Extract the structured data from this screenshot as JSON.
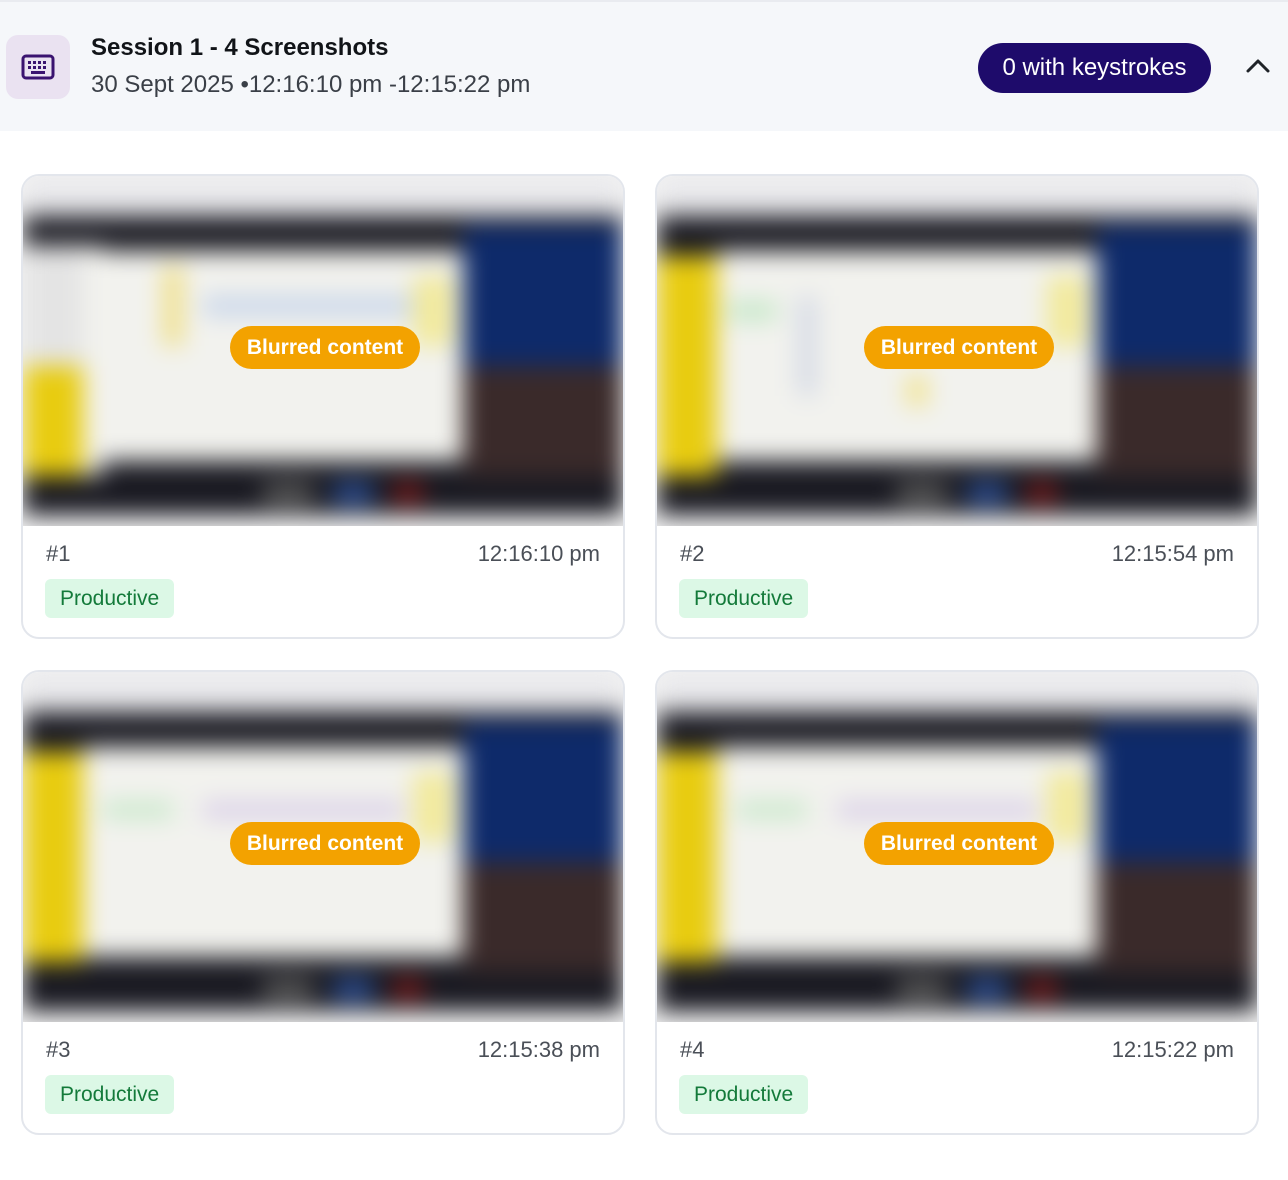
{
  "session": {
    "title": "Session 1 - 4 Screenshots",
    "subtitle": "30 Sept 2025 •12:16:10 pm -12:15:22 pm",
    "icon": "keyboard-icon",
    "keystrokes_label": "0 with keystrokes",
    "collapse_icon": "chevron-up-icon"
  },
  "colors": {
    "header_bg": "#f5f7fa",
    "icon_bg": "#eae2f1",
    "icon_color": "#3a1370",
    "pill_bg": "#1e0b6b",
    "blur_badge_bg": "#f3a200",
    "productive_bg": "#dcf8e6",
    "productive_text": "#137a3a"
  },
  "screenshots": [
    {
      "index": "#1",
      "time": "12:16:10 pm",
      "status": "Productive",
      "overlay": "Blurred content"
    },
    {
      "index": "#2",
      "time": "12:15:54 pm",
      "status": "Productive",
      "overlay": "Blurred content"
    },
    {
      "index": "#3",
      "time": "12:15:38 pm",
      "status": "Productive",
      "overlay": "Blurred content"
    },
    {
      "index": "#4",
      "time": "12:15:22 pm",
      "status": "Productive",
      "overlay": "Blurred content"
    }
  ]
}
